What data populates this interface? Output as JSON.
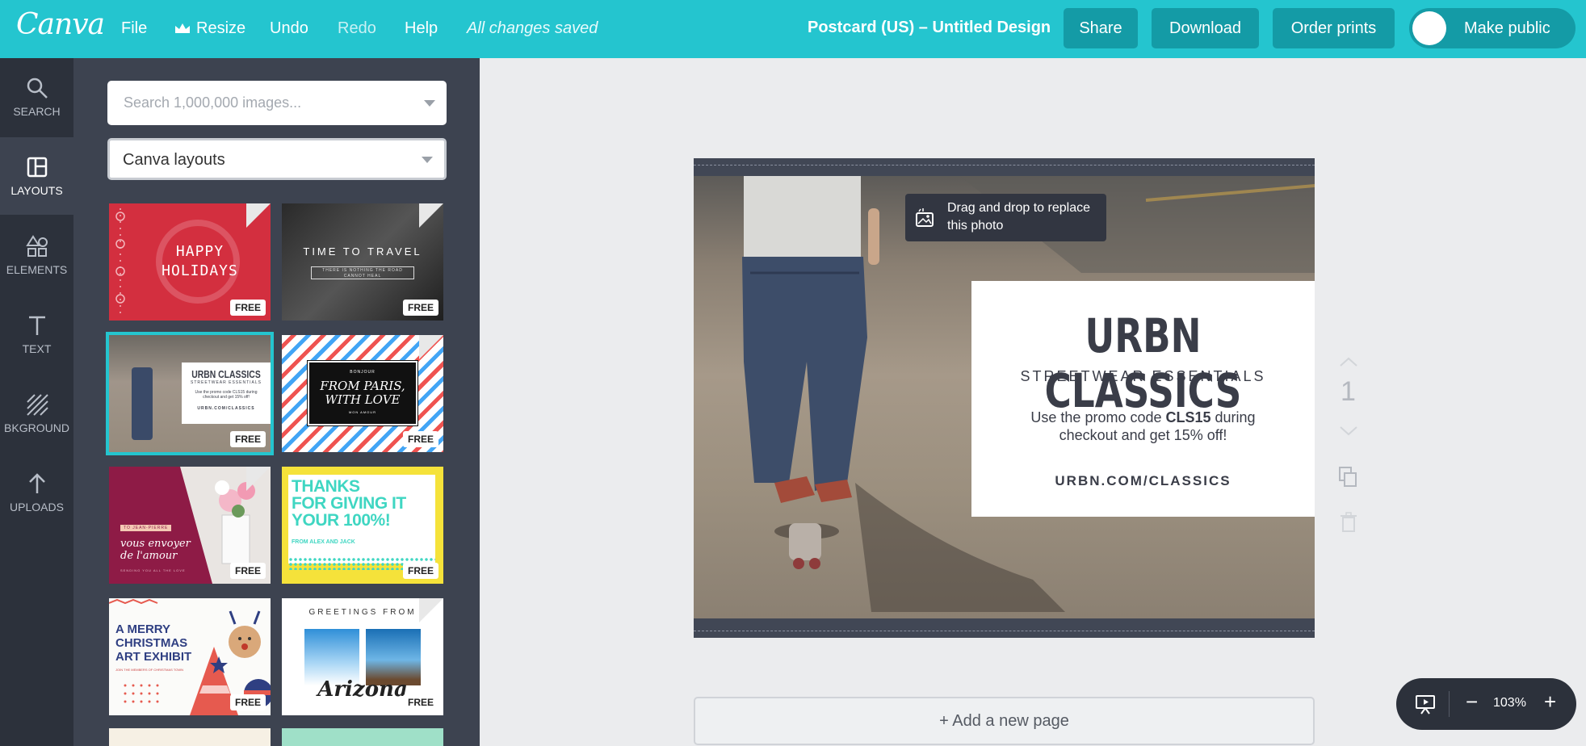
{
  "topbar": {
    "logo": "Canva",
    "menu": {
      "file": "File",
      "resize": "Resize",
      "undo": "Undo",
      "redo": "Redo",
      "help": "Help"
    },
    "status": "All changes saved",
    "doc_title": "Postcard (US) – Untitled Design",
    "share": "Share",
    "download": "Download",
    "order_prints": "Order prints",
    "make_public": "Make public"
  },
  "rail": {
    "search": "SEARCH",
    "layouts": "LAYOUTS",
    "elements": "ELEMENTS",
    "text": "TEXT",
    "background": "BKGROUND",
    "uploads": "UPLOADS",
    "active": "layouts"
  },
  "panel": {
    "search_placeholder": "Search 1,000,000 images...",
    "layout_select": "Canva layouts",
    "free_label": "FREE",
    "thumbs": {
      "holidays": {
        "line1": "HAPPY",
        "line2": "HOLIDAYS"
      },
      "travel": {
        "title": "TIME TO TRAVEL",
        "sub": "THERE IS NOTHING THE ROAD CANNOT HEAL"
      },
      "urbn": {
        "title": "URBN CLASSICS",
        "sub": "STREETWEAR ESSENTIALS",
        "body": "Use the promo code CLS15 during checkout and get 15% off!",
        "url": "URBN.COM/CLASSICS"
      },
      "paris": {
        "top": "BONJOUR",
        "line1": "FROM PARIS,",
        "line2": "WITH LOVE",
        "bottom": "MON AMOUR"
      },
      "amour": {
        "tag": "TO JEAN-PIERRE",
        "line1": "vous envoyer",
        "line2": "de l'amour",
        "bottom": "SENDING YOU ALL THE LOVE"
      },
      "thanks": {
        "line1": "THANKS",
        "line2": "FOR GIVING IT",
        "line3": "YOUR 100%!",
        "from": "FROM ALEX AND JACK"
      },
      "christmas": {
        "line1": "A MERRY",
        "line2": "CHRISTMAS",
        "line3": "ART EXHIBIT",
        "sub": "JOIN THE MEMBERS OF CHRISTMAS TOWN"
      },
      "arizona": {
        "top": "GREETINGS FROM",
        "script": "Arizona"
      }
    }
  },
  "canvas": {
    "tooltip": "Drag and drop to replace this photo",
    "promo": {
      "title": "URBN CLASSICS",
      "subtitle": "STREETWEAR ESSENTIALS",
      "body_pre": "Use the promo code ",
      "code": "CLS15",
      "body_post": " during checkout and get 15% off!",
      "url": "URBN.COM/CLASSICS"
    },
    "page_number": "1",
    "add_page": "+ Add a new page"
  },
  "zoom": {
    "minus": "−",
    "value": "103%",
    "plus": "+"
  },
  "colors": {
    "brand": "#24c5cf",
    "button": "#149ba6",
    "rail": "#2c313b",
    "panel": "#3d4350",
    "workspace": "#ebecee"
  }
}
